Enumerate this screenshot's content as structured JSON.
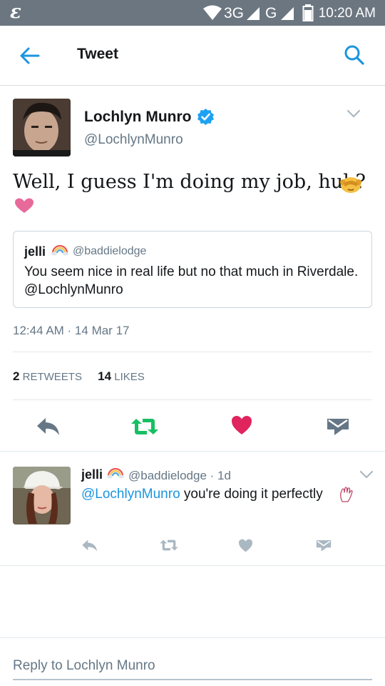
{
  "status_bar": {
    "network_1": "3G",
    "network_2": "G",
    "time": "10:20 AM"
  },
  "header": {
    "title": "Tweet",
    "back_icon": "back-arrow-icon",
    "search_icon": "search-icon"
  },
  "tweet": {
    "author_name": "Lochlyn Munro",
    "author_handle": "@LochlynMunro",
    "verified": true,
    "text": "Well, I guess I'm doing my job, huh?",
    "emojis": [
      "see-no-evil-monkey",
      "pink-heart"
    ],
    "quoted": {
      "name": "jelli",
      "handle": "@baddielodge",
      "text": "You seem nice in real life but no that much in Riverdale. @LochlynMunro"
    },
    "timestamp": "12:44 AM · 14 Mar 17",
    "retweets_count": "2",
    "retweets_label": "RETWEETS",
    "likes_count": "14",
    "likes_label": "LIKES"
  },
  "colors": {
    "accent_blue": "#1b95e0",
    "retweet_green": "#17bf63",
    "like_red": "#e0245e",
    "muted_gray": "#657786",
    "statusbar": "#6b7680"
  },
  "reply": {
    "name": "jelli",
    "handle": "@baddielodge",
    "age": "· 1d",
    "mention": "@LochlynMunro",
    "text": " you're doing it perfectly"
  },
  "reply_box": {
    "placeholder": "Reply to Lochlyn Munro"
  }
}
